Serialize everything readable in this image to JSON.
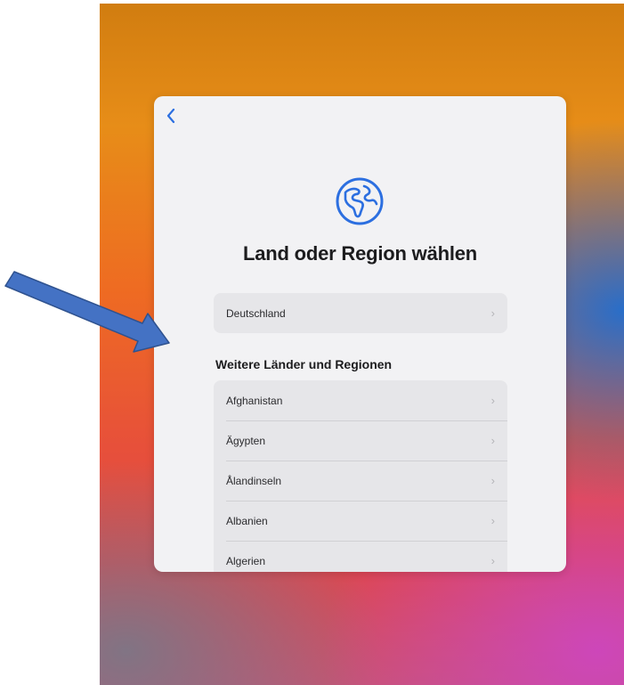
{
  "screen": {
    "title": "Land oder Region wählen",
    "back_icon": "chevron-left-icon",
    "hero_icon": "globe-icon",
    "accent_color": "#2c6fe0"
  },
  "suggested": {
    "items": [
      {
        "label": "Deutschland",
        "icon": "chevron-right-icon"
      }
    ]
  },
  "other": {
    "heading": "Weitere Länder und Regionen",
    "items": [
      {
        "label": "Afghanistan",
        "icon": "chevron-right-icon"
      },
      {
        "label": "Ägypten",
        "icon": "chevron-right-icon"
      },
      {
        "label": "Ålandinseln",
        "icon": "chevron-right-icon"
      },
      {
        "label": "Albanien",
        "icon": "chevron-right-icon"
      },
      {
        "label": "Algerien",
        "icon": "chevron-right-icon"
      }
    ]
  },
  "annotation": {
    "arrow_color": "#4472c4",
    "arrow_icon": "annotation-arrow"
  }
}
